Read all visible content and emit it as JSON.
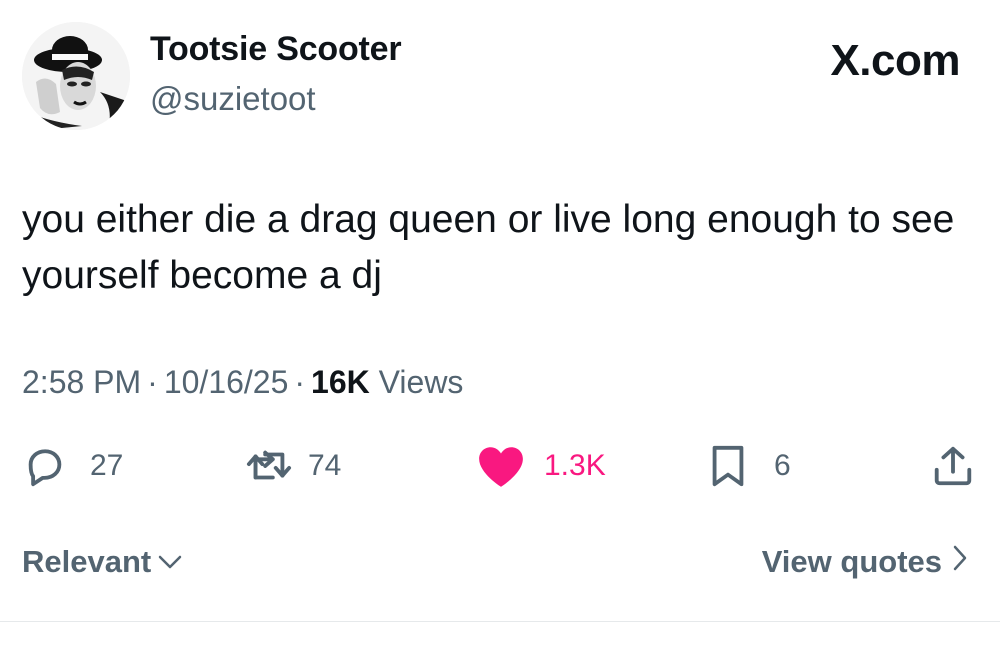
{
  "header": {
    "display_name": "Tootsie Scooter",
    "handle": "@suzietoot",
    "brand": "X.com"
  },
  "tweet": {
    "text": "you either die a drag queen or live long enough to see yourself become a dj",
    "time": "2:58 PM",
    "date": "10/16/25",
    "separator": "·",
    "views_count": "16K",
    "views_label": "Views"
  },
  "actions": {
    "replies": "27",
    "reposts": "74",
    "likes": "1.3K",
    "bookmarks": "6"
  },
  "footer": {
    "sort_label": "Relevant",
    "quotes_label": "View quotes"
  },
  "colors": {
    "like_accent": "#f91880",
    "secondary_text": "#536471",
    "primary_text": "#0f1419"
  },
  "icons": [
    "reply-icon",
    "repost-icon",
    "heart-icon",
    "bookmark-icon",
    "share-icon",
    "chevron-down-icon",
    "chevron-right-icon"
  ]
}
